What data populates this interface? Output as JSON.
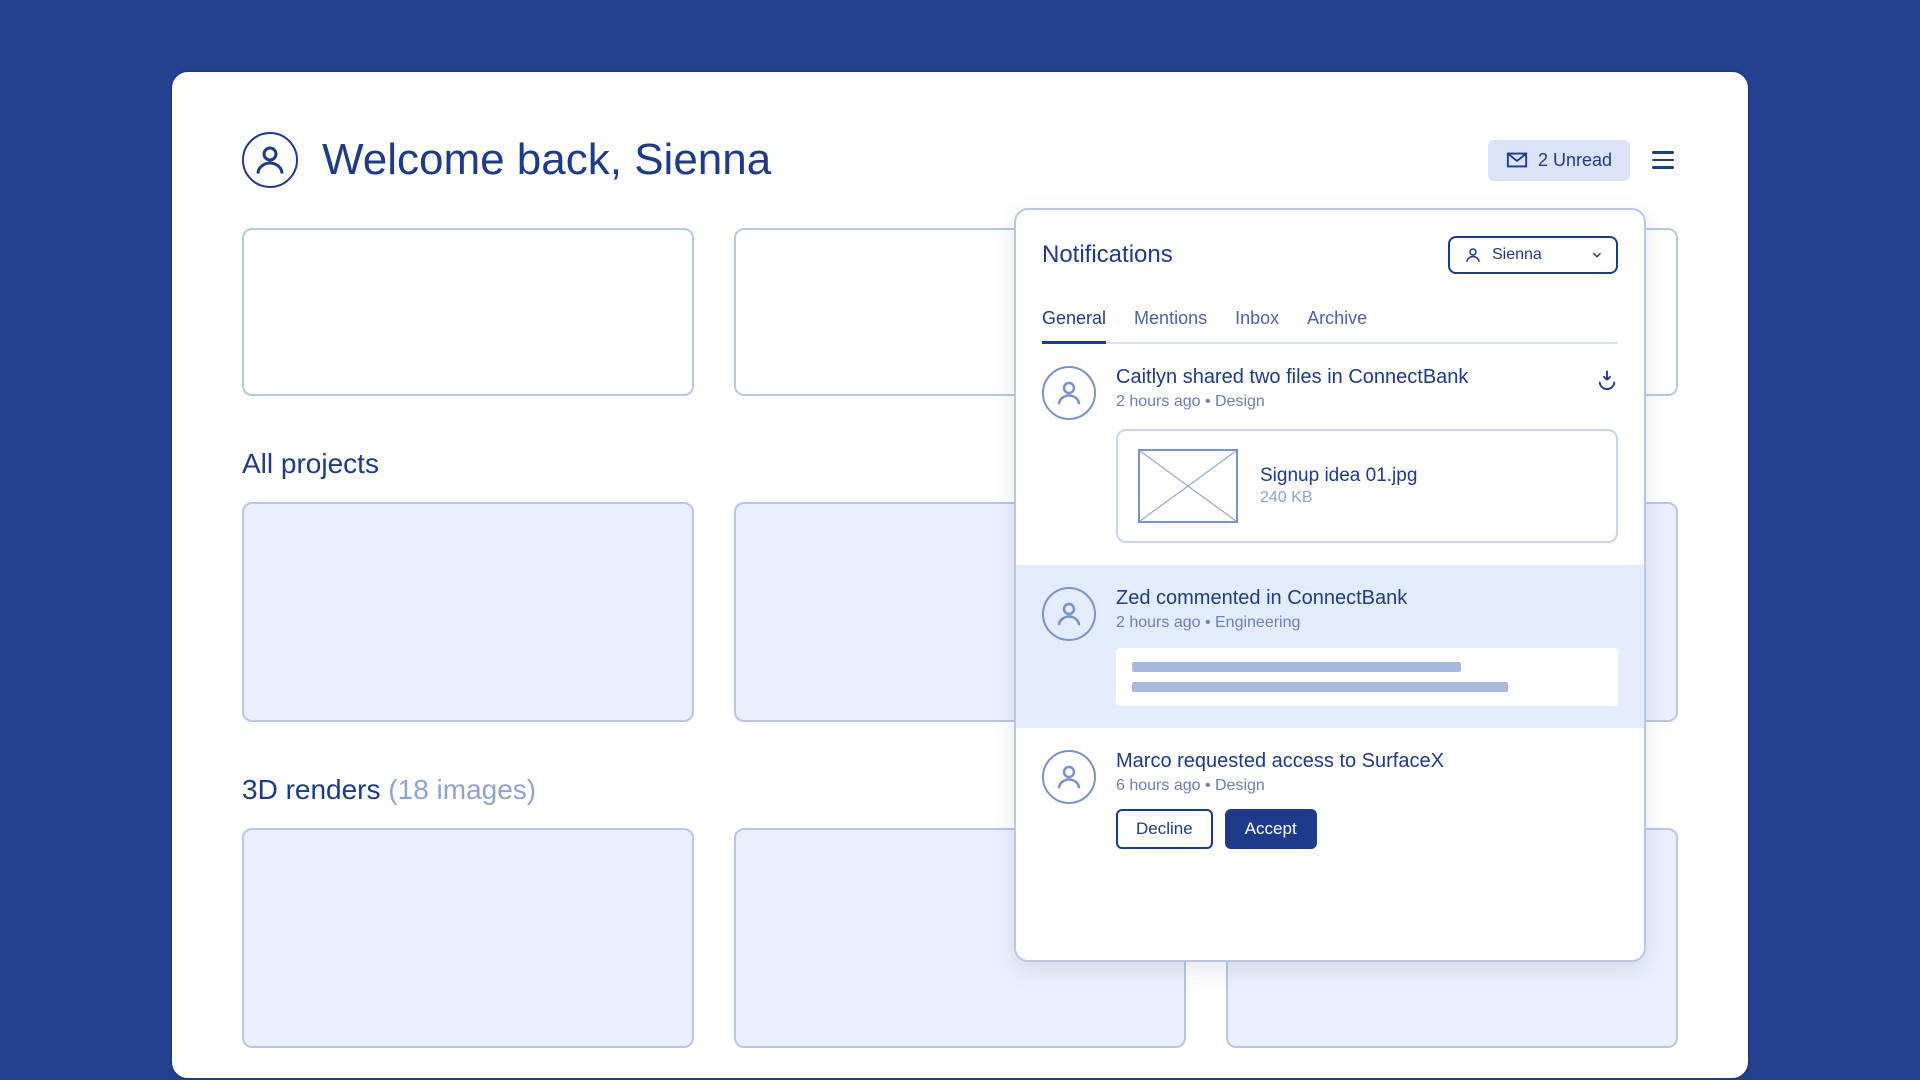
{
  "header": {
    "title": "Welcome back, Sienna",
    "unread_label": "2 Unread"
  },
  "sections": {
    "all_projects": "All projects",
    "renders_label": "3D renders ",
    "renders_count": "(18 images)"
  },
  "panel": {
    "title": "Notifications",
    "user": "Sienna",
    "tabs": {
      "general": "General",
      "mentions": "Mentions",
      "inbox": "Inbox",
      "archive": "Archive"
    },
    "items": [
      {
        "title": "Caitlyn shared two files in ConnectBank",
        "meta": "2 hours ago • Design",
        "file": {
          "name": "Signup idea 01.jpg",
          "size": "240 KB"
        }
      },
      {
        "title": "Zed commented in ConnectBank",
        "meta": "2 hours ago • Engineering"
      },
      {
        "title": "Marco requested access to SurfaceX",
        "meta": "6 hours ago • Design",
        "decline": "Decline",
        "accept": "Accept"
      }
    ]
  }
}
